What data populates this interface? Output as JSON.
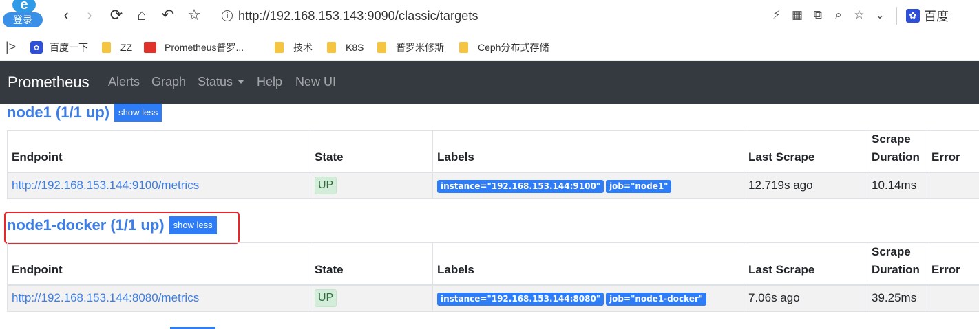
{
  "browser": {
    "login_label": "登录",
    "logo_letter": "e",
    "nav": {
      "back": "‹",
      "forward": "›",
      "reload": "⟳",
      "home": "⌂",
      "undo": "↶",
      "star": "☆"
    },
    "url": {
      "host": "http://192.168.153.143",
      "path": ":9090/classic/targets"
    },
    "search_engine": "百度",
    "search_engine_icon": "paw-icon"
  },
  "bookmarks": [
    {
      "label": "百度一下",
      "icon": "baidu-icon"
    },
    {
      "label": "ZZ",
      "icon": "folder-icon"
    },
    {
      "label": "Prometheus普罗...",
      "icon": "prometheus-icon"
    },
    {
      "label": "技术",
      "icon": "folder-icon"
    },
    {
      "label": "K8S",
      "icon": "folder-icon"
    },
    {
      "label": "普罗米修斯",
      "icon": "folder-icon"
    },
    {
      "label": "Ceph分布式存储",
      "icon": "folder-icon"
    }
  ],
  "navbar": {
    "brand": "Prometheus",
    "links": [
      "Alerts",
      "Graph",
      "Status",
      "Help",
      "New UI"
    ]
  },
  "table_headers": {
    "endpoint": "Endpoint",
    "state": "State",
    "labels": "Labels",
    "last_scrape": "Last Scrape",
    "scrape_duration": "Scrape Duration",
    "error": "Error"
  },
  "jobs": [
    {
      "title": "node1 (1/1 up)",
      "toggle_label": "show less",
      "target": {
        "endpoint": "http://192.168.153.144:9100/metrics",
        "state": "UP",
        "labels": [
          "instance=\"192.168.153.144:9100\"",
          "job=\"node1\""
        ],
        "last_scrape": "12.719s ago",
        "scrape_duration": "10.14ms",
        "error": ""
      }
    },
    {
      "title": "node1-docker (1/1 up)",
      "toggle_label": "show less",
      "target": {
        "endpoint": "http://192.168.153.144:8080/metrics",
        "state": "UP",
        "labels": [
          "instance=\"192.168.153.144:8080\"",
          "job=\"node1-docker\""
        ],
        "last_scrape": "7.06s ago",
        "scrape_duration": "39.25ms",
        "error": ""
      }
    }
  ],
  "colors": {
    "navbar_bg": "#343a40",
    "link_blue": "#3c7ee6",
    "button_blue": "#2f7df6",
    "highlight_red": "#e8262b",
    "up_green_bg": "#d4edda"
  }
}
